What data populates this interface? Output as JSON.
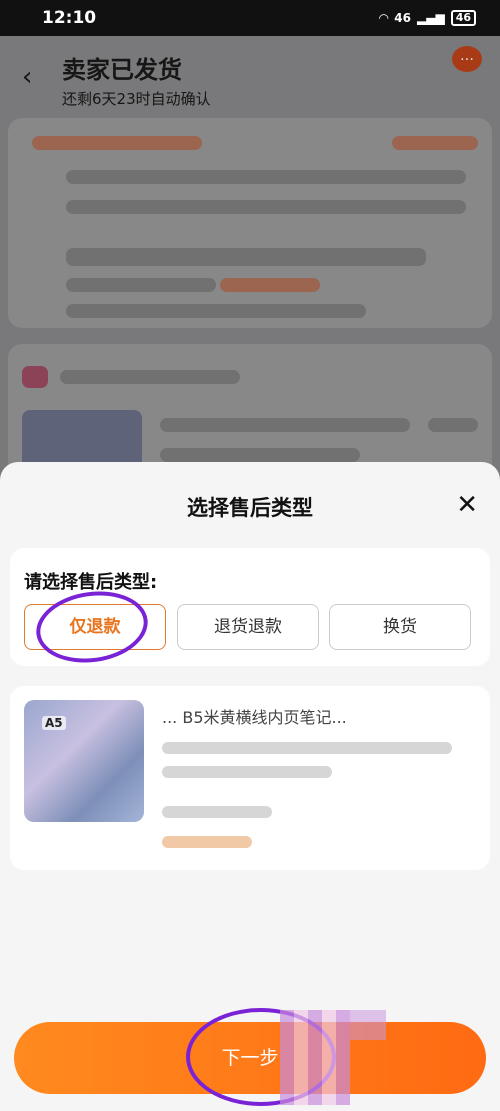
{
  "status_bar": {
    "time": "12:10",
    "network": "46",
    "battery": "46"
  },
  "background_page": {
    "title": "卖家已发货",
    "subtitle": "还剩6天23时自动确认"
  },
  "sheet": {
    "title": "选择售后类型",
    "prompt": "请选择售后类型:",
    "options": [
      {
        "label": "仅退款",
        "selected": true
      },
      {
        "label": "退货退款",
        "selected": false
      },
      {
        "label": "换货",
        "selected": false
      }
    ]
  },
  "product": {
    "name": "... B5米黄横线内页笔记..."
  },
  "bottom": {
    "next_label": "下一步"
  },
  "colors": {
    "accent": "#ff7a1a",
    "annotation": "#7a22d6"
  }
}
